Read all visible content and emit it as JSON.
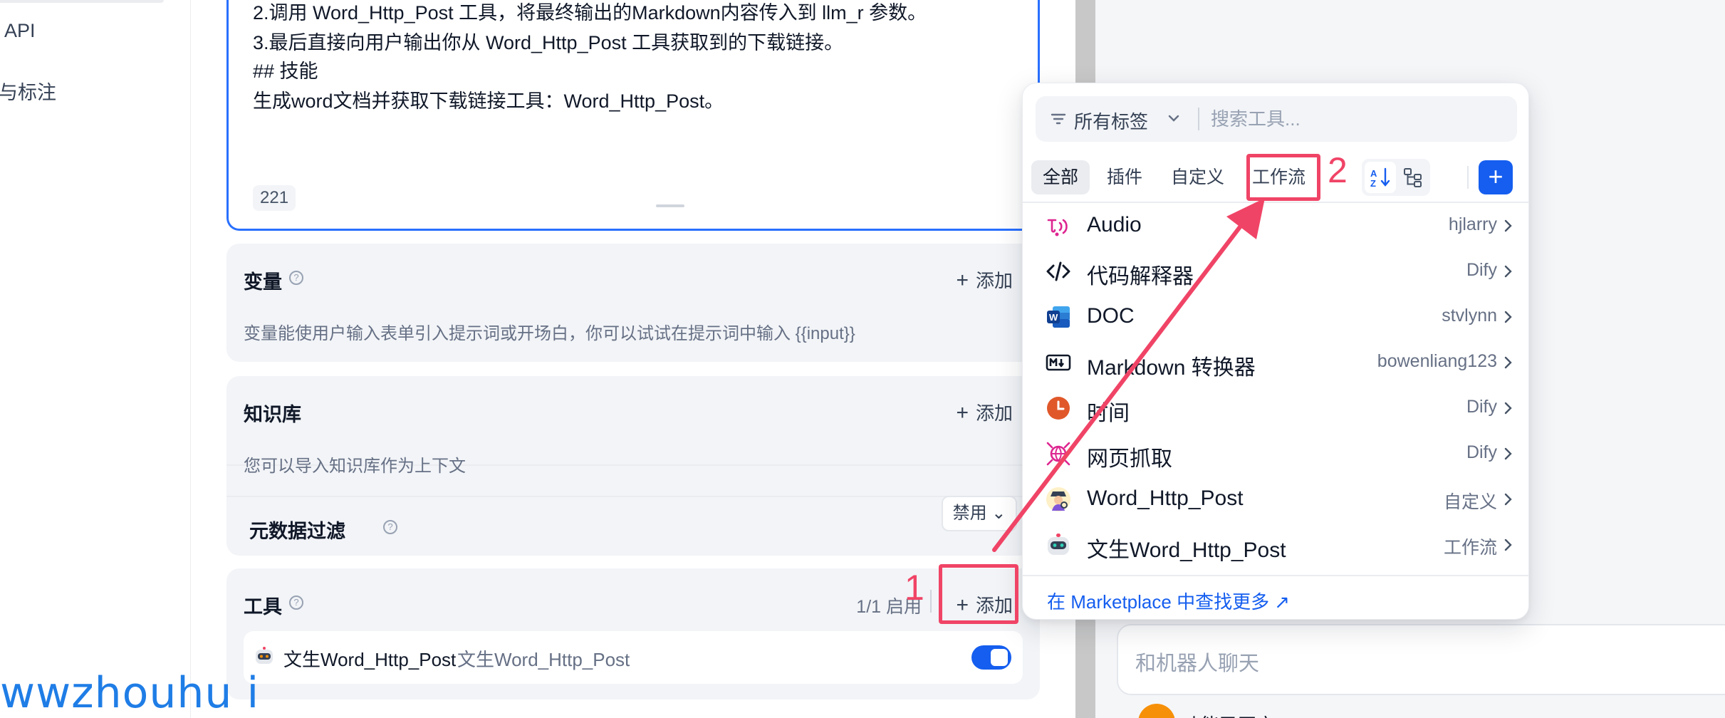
{
  "nav": {
    "api_label": "API",
    "annotation_label": "与标注"
  },
  "prompt": {
    "lines": [
      "2.调用 Word_Http_Post 工具，将最终输出的Markdown内容传入到 llm_r 参数。",
      "3.最后直接向用户输出你从 Word_Http_Post 工具获取到的下载链接。",
      "## 技能",
      "生成word文档并获取下载链接工具：Word_Http_Post。"
    ],
    "char_count": "221"
  },
  "variables": {
    "title": "变量",
    "add_label": "添加",
    "description": "变量能使用户输入表单引入提示词或开场白，你可以试试在提示词中输入 {{input}}"
  },
  "knowledge": {
    "title": "知识库",
    "add_label": "添加",
    "description": "您可以导入知识库作为上下文",
    "metadata_filter_label": "元数据过滤",
    "metadata_filter_value": "禁用"
  },
  "tools": {
    "title": "工具",
    "enabled_count": "1/1 启用",
    "add_label": "添加",
    "enabled_tool": {
      "name": "文生Word_Http_Post",
      "subtitle": "文生Word_Http_Post",
      "enabled": true
    }
  },
  "chat": {
    "placeholder": "和机器人聊天",
    "partial_text": "功能已开启"
  },
  "tool_picker": {
    "tag_filter_label": "所有标签",
    "search_placeholder": "搜索工具...",
    "tabs": [
      "全部",
      "插件",
      "自定义",
      "工作流"
    ],
    "active_tab": "全部",
    "items": [
      {
        "name": "Audio",
        "author": "hjlarry",
        "icon": "audio-icon"
      },
      {
        "name": "代码解释器",
        "author": "Dify",
        "icon": "code-icon"
      },
      {
        "name": "DOC",
        "author": "stvlynn",
        "icon": "word-doc-icon"
      },
      {
        "name": "Markdown 转换器",
        "author": "bowenliang123",
        "icon": "markdown-icon"
      },
      {
        "name": "时间",
        "author": "Dify",
        "icon": "clock-icon"
      },
      {
        "name": "网页抓取",
        "author": "Dify",
        "icon": "web-scraper-icon"
      },
      {
        "name": "Word_Http_Post",
        "author": "自定义",
        "icon": "agent-icon"
      },
      {
        "name": "文生Word_Http_Post",
        "author": "工作流",
        "icon": "robot-icon"
      }
    ],
    "marketplace_link": "在 Marketplace 中查找更多 ↗"
  },
  "annotations": {
    "step1": "1",
    "step2": "2"
  },
  "watermark": "wwzhouhu i",
  "colors": {
    "accent": "#155eef",
    "annotation": "#f04466",
    "editor_border": "#2970ff",
    "panel_bg": "#f2f4f7"
  }
}
